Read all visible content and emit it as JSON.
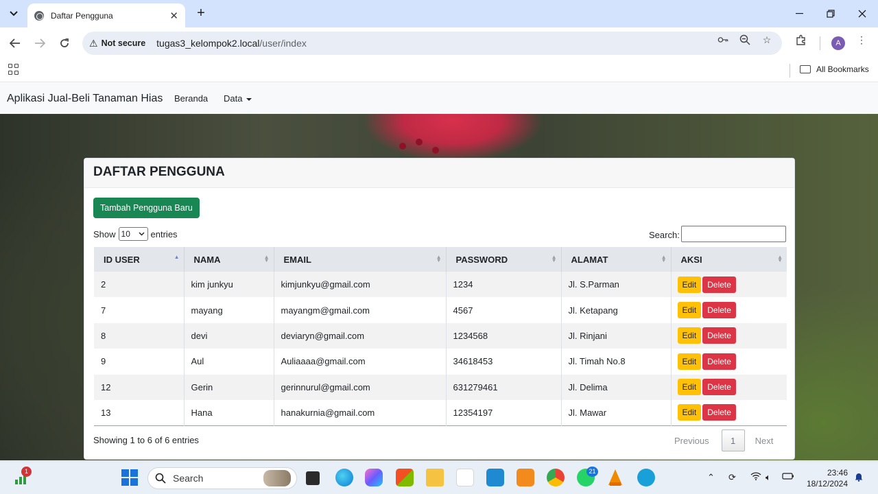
{
  "browser": {
    "tab_title": "Daftar Pengguna",
    "not_secure": "Not secure",
    "url_host": "tugas3_kelompok2.local",
    "url_path": "/user/index",
    "profile_initial": "A",
    "all_bookmarks": "All Bookmarks"
  },
  "site_nav": {
    "brand": "Aplikasi Jual-Beli Tanaman Hias",
    "home": "Beranda",
    "data": "Data"
  },
  "card": {
    "title": "DAFTAR PENGGUNA",
    "add_button": "Tambah Pengguna Baru",
    "show_label": "Show",
    "entries_value": "10",
    "entries_label": "entries",
    "search_label": "Search:",
    "search_value": ""
  },
  "table": {
    "columns": [
      "ID USER",
      "NAMA",
      "EMAIL",
      "PASSWORD",
      "ALAMAT",
      "AKSI"
    ],
    "edit_label": "Edit",
    "delete_label": "Delete",
    "rows": [
      {
        "id": "2",
        "nama": "kim junkyu",
        "email": "kimjunkyu@gmail.com",
        "password": "1234",
        "alamat": "Jl. S.Parman"
      },
      {
        "id": "7",
        "nama": "mayang",
        "email": "mayangm@gmail.com",
        "password": "4567",
        "alamat": "Jl. Ketapang"
      },
      {
        "id": "8",
        "nama": "devi",
        "email": "deviaryn@gmail.com",
        "password": "1234568",
        "alamat": "Jl. Rinjani"
      },
      {
        "id": "9",
        "nama": "Aul",
        "email": "Auliaaaa@gmail.com",
        "password": "34618453",
        "alamat": "Jl. Timah No.8"
      },
      {
        "id": "12",
        "nama": "Gerin",
        "email": "gerinnurul@gmail.com",
        "password": "631279461",
        "alamat": "Jl. Delima"
      },
      {
        "id": "13",
        "nama": "Hana",
        "email": "hanakurnia@gmail.com",
        "password": "12354197",
        "alamat": "Jl. Mawar"
      }
    ]
  },
  "footer": {
    "info": "Showing 1 to 6 of 6 entries",
    "previous": "Previous",
    "page": "1",
    "next": "Next"
  },
  "taskbar": {
    "search_placeholder": "Search",
    "widget_badge": "1",
    "whatsapp_badge": "21",
    "time": "23:46",
    "date": "18/12/2024"
  }
}
